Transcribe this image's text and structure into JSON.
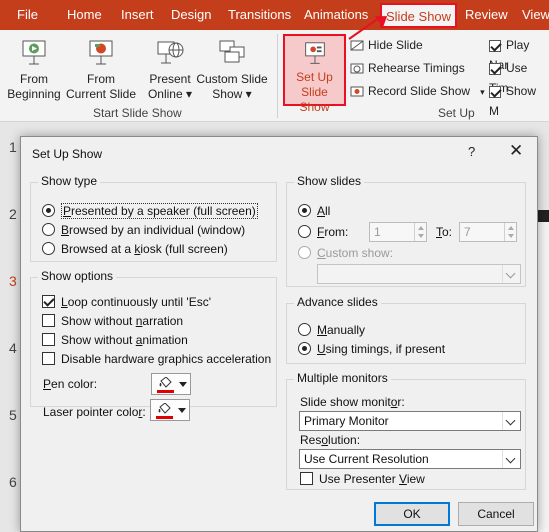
{
  "ribbon": {
    "tabs": [
      {
        "label": "File"
      },
      {
        "label": "Home"
      },
      {
        "label": "Insert"
      },
      {
        "label": "Design"
      },
      {
        "label": "Transitions"
      },
      {
        "label": "Animations"
      },
      {
        "label": "Slide Show",
        "active": true
      },
      {
        "label": "Review"
      },
      {
        "label": "View"
      }
    ],
    "start_group": {
      "label": "Start Slide Show",
      "buttons": [
        {
          "line1": "From",
          "line2": "Beginning",
          "icon": "play-from-beginning-icon"
        },
        {
          "line1": "From",
          "line2": "Current Slide",
          "icon": "play-from-current-icon"
        },
        {
          "line1": "Present",
          "line2": "Online",
          "icon": "present-online-icon"
        },
        {
          "line1": "Custom Slide",
          "line2": "Show",
          "icon": "custom-show-icon"
        }
      ]
    },
    "setup_group": {
      "label": "Set Up",
      "setup_button": {
        "line1": "Set Up",
        "line2": "Slide Show",
        "icon": "setup-slideshow-icon"
      },
      "hide_slide": "Hide Slide",
      "rehearse": "Rehearse Timings",
      "record": "Record Slide Show",
      "play_narrations": "Play Nar",
      "use_timings": "Use Tim",
      "show_media": "Show M"
    },
    "colors": {
      "tabbar": "#c43e1c",
      "highlight": "#e81123"
    }
  },
  "thumbnails": [
    "1",
    "2",
    "3",
    "4",
    "5",
    "6"
  ],
  "dialog": {
    "title": "Set Up Show",
    "help": "?",
    "close": "✕",
    "show_type": {
      "label": "Show type",
      "options": [
        {
          "pre": "",
          "key": "P",
          "post": "resented by a speaker (full screen)",
          "selected": true
        },
        {
          "pre": "",
          "key": "B",
          "post": "rowsed by an individual (window)",
          "selected": false
        },
        {
          "pre": "Browsed at a ",
          "key": "k",
          "post": "iosk (full screen)",
          "selected": false
        }
      ]
    },
    "show_options": {
      "label": "Show options",
      "checks": [
        {
          "pre": "",
          "key": "L",
          "post": "oop continuously until 'Esc'",
          "checked": true
        },
        {
          "pre": "Show without ",
          "key": "n",
          "post": "arration",
          "checked": false
        },
        {
          "pre": "Show without ",
          "key": "a",
          "post": "nimation",
          "checked": false
        },
        {
          "pre": "Disable hardware ",
          "key": "g",
          "post": "raphics acceleration",
          "checked": false
        }
      ],
      "pen_color": {
        "pre": "",
        "key": "P",
        "post": "en color:"
      },
      "laser_color": {
        "pre": "Laser pointer colo",
        "key": "r",
        "post": ":"
      },
      "pen_swatch": "#e00000",
      "laser_swatch": "#e00000"
    },
    "show_slides": {
      "label": "Show slides",
      "all": {
        "pre": "",
        "key": "A",
        "post": "ll",
        "selected": true
      },
      "from": {
        "pre": "",
        "key": "F",
        "post": "rom:",
        "value": "1"
      },
      "to": {
        "pre": "",
        "key": "T",
        "post": "o:",
        "value": "7"
      },
      "custom": {
        "pre": "",
        "key": "C",
        "post": "ustom show:",
        "value": ""
      }
    },
    "advance_slides": {
      "label": "Advance slides",
      "manually": {
        "pre": "",
        "key": "M",
        "post": "anually",
        "selected": false
      },
      "timings": {
        "pre": "",
        "key": "U",
        "post": "sing timings, if present",
        "selected": true
      }
    },
    "monitors": {
      "label": "Multiple monitors",
      "monitor_label": {
        "pre": "Slide show monit",
        "key": "o",
        "post": "r:"
      },
      "monitor_value": "Primary Monitor",
      "resolution_label": {
        "pre": "Res",
        "key": "o",
        "post": "lution:"
      },
      "resolution_value": "Use Current Resolution",
      "presenter_view": {
        "pre": "Use Presenter ",
        "key": "V",
        "post": "iew",
        "checked": false
      }
    },
    "ok": "OK",
    "cancel": "Cancel"
  }
}
